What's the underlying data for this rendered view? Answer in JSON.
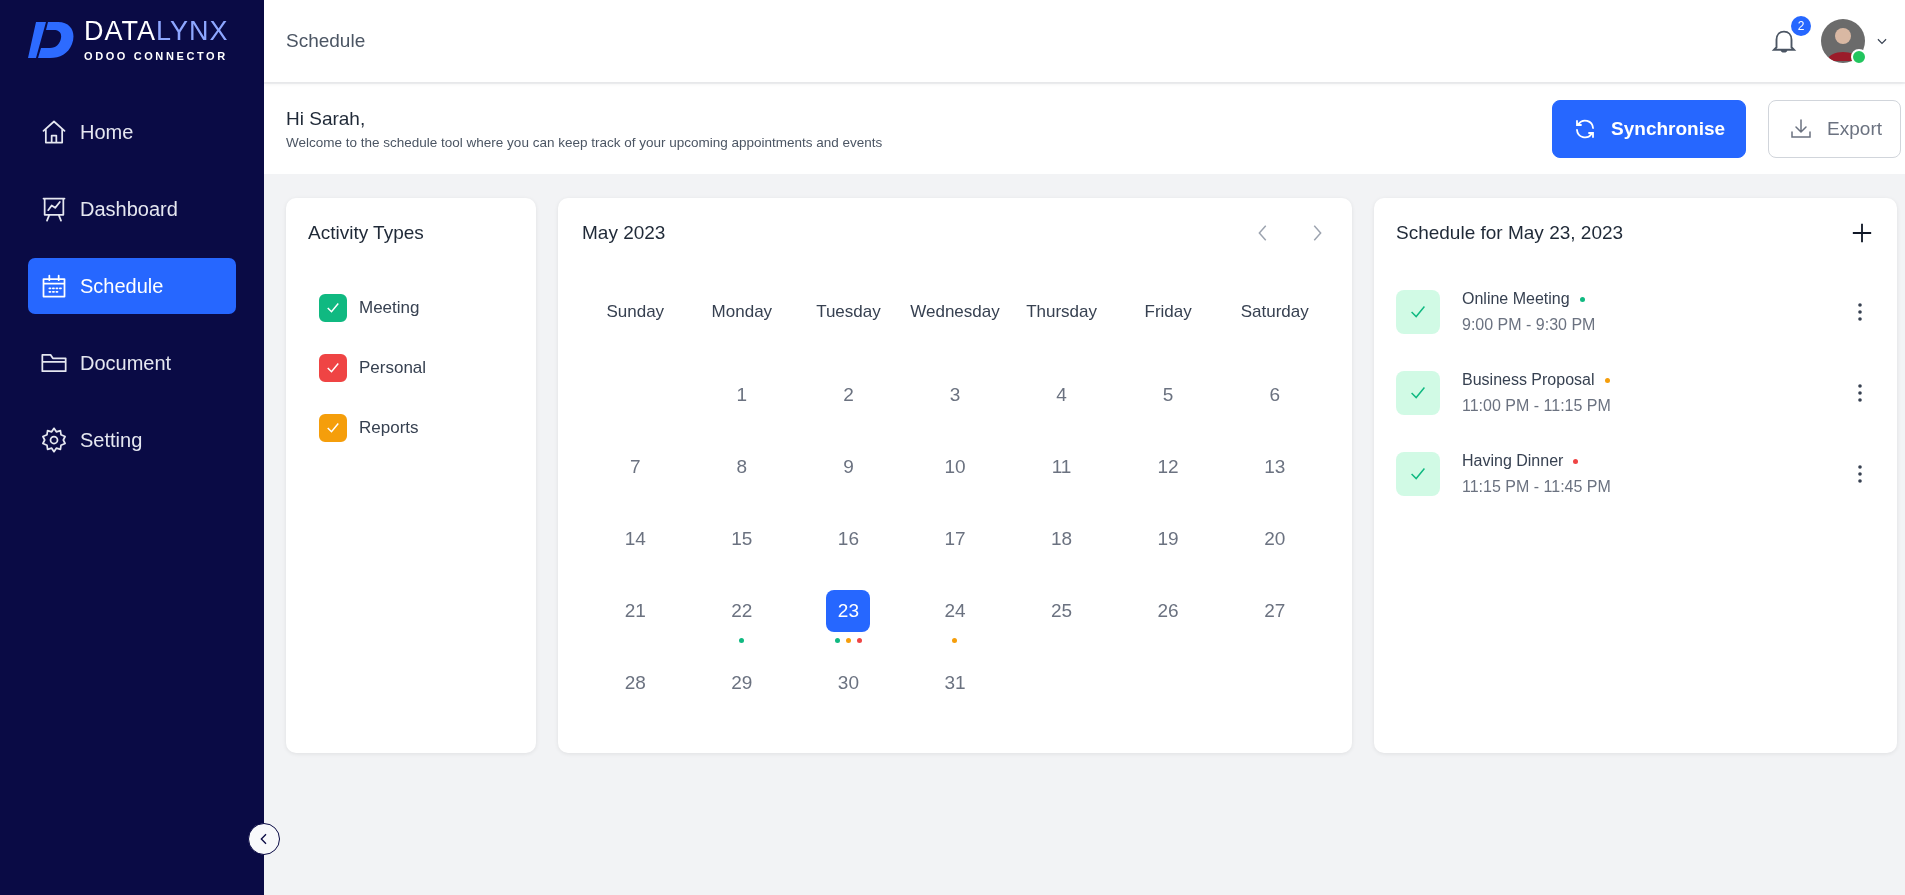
{
  "brand": {
    "name_start": "DATA",
    "name_end": "LYNX",
    "tagline": "ODOO CONNECTOR"
  },
  "sidebar": {
    "items": [
      {
        "label": "Home",
        "selected": false
      },
      {
        "label": "Dashboard",
        "selected": false
      },
      {
        "label": "Schedule",
        "selected": true
      },
      {
        "label": "Document",
        "selected": false
      },
      {
        "label": "Setting",
        "selected": false
      }
    ]
  },
  "header": {
    "title": "Schedule",
    "notifications": "2",
    "user": {
      "online": true
    }
  },
  "greeting": {
    "title": "Hi Sarah,",
    "subtitle": "Welcome to the schedule tool where you can keep track of your upcoming appointments and events"
  },
  "actions": [
    {
      "label": "Synchronise",
      "kind": "sync",
      "primary": true
    },
    {
      "label": "Export",
      "kind": "export",
      "primary": false
    }
  ],
  "activity_types": {
    "title": "Activity Types",
    "items": [
      {
        "label": "Meeting",
        "checked": true,
        "color": "#10b981"
      },
      {
        "label": "Personal",
        "checked": true,
        "color": "#ef4444"
      },
      {
        "label": "Reports",
        "checked": true,
        "color": "#f59e0b"
      }
    ]
  },
  "calendar": {
    "title": "May 2023",
    "weekdays": [
      "Sunday",
      "Monday",
      "Tuesday",
      "Wednesday",
      "Thursday",
      "Friday",
      "Saturday"
    ],
    "weeks": [
      [
        {
          "day": "1",
          "selected": false
        },
        {
          "day": "2",
          "selected": false
        },
        {
          "day": "3",
          "selected": false
        },
        {
          "day": "4",
          "selected": false
        },
        {
          "day": "5",
          "selected": false
        },
        {
          "day": "6",
          "selected": false
        }
      ],
      [
        {
          "day": "7",
          "selected": false
        },
        {
          "day": "8",
          "selected": false
        },
        {
          "day": "9",
          "selected": false
        },
        {
          "day": "10",
          "selected": false
        },
        {
          "day": "11",
          "selected": false
        },
        {
          "day": "12",
          "selected": false
        },
        {
          "day": "13",
          "selected": false
        }
      ],
      [
        {
          "day": "14",
          "selected": false
        },
        {
          "day": "15",
          "selected": false
        },
        {
          "day": "16",
          "selected": false
        },
        {
          "day": "17",
          "selected": false
        },
        {
          "day": "18",
          "selected": false
        },
        {
          "day": "19",
          "selected": false
        },
        {
          "day": "20",
          "selected": false
        }
      ],
      [
        {
          "day": "21",
          "selected": false
        },
        {
          "day": "22",
          "selected": false,
          "events": [
            {
              "color": "#10b981"
            }
          ]
        },
        {
          "day": "23",
          "selected": true,
          "events": [
            {
              "color": "#10b981"
            },
            {
              "color": "#f59e0b"
            },
            {
              "color": "#ef4444"
            }
          ]
        },
        {
          "day": "24",
          "selected": false,
          "events": [
            {
              "color": "#f59e0b"
            }
          ]
        },
        {
          "day": "25",
          "selected": false
        },
        {
          "day": "26",
          "selected": false
        },
        {
          "day": "27",
          "selected": false
        }
      ],
      [
        {
          "day": "28",
          "selected": false
        },
        {
          "day": "29",
          "selected": false
        },
        {
          "day": "30",
          "selected": false
        },
        {
          "day": "31",
          "selected": false
        }
      ]
    ]
  },
  "schedule": {
    "title": "Schedule for May 23, 2023",
    "items": [
      {
        "title": "Online Meeting",
        "time": "9:00 PM - 9:30 PM",
        "color": "#10b981",
        "checked": true
      },
      {
        "title": "Business Proposal",
        "time": "11:00 PM - 11:15 PM",
        "color": "#f59e0b",
        "checked": true
      },
      {
        "title": "Having Dinner",
        "time": "11:15 PM - 11:45 PM",
        "color": "#ef4444",
        "checked": true
      }
    ]
  }
}
